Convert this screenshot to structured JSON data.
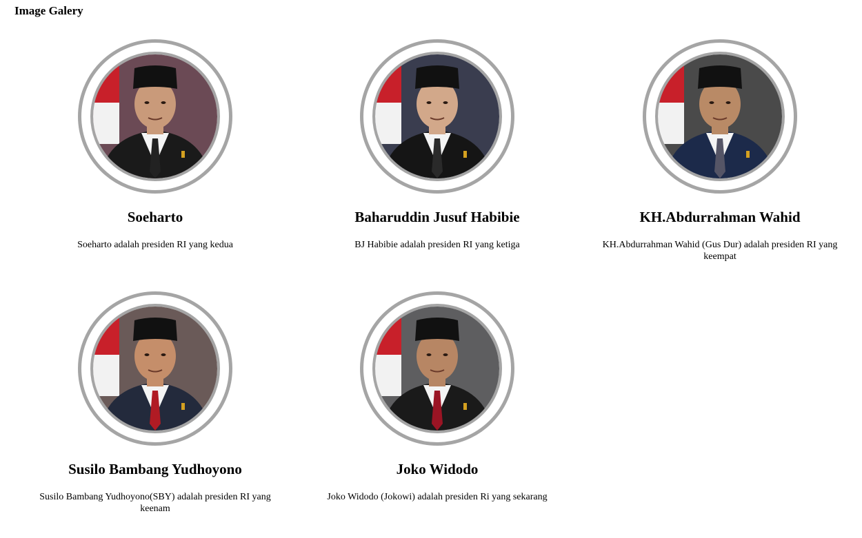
{
  "page": {
    "title": "Image Galery"
  },
  "gallery": {
    "items": [
      {
        "name": "Soeharto",
        "description": "Soeharto adalah presiden RI yang kedua",
        "photo_alt": "Portrait of Soeharto",
        "bg": "#6b4a55",
        "suit": "#1a1a1a",
        "tie": "#222222",
        "skin": "#c99a7a"
      },
      {
        "name": "Baharuddin Jusuf Habibie",
        "description": "BJ Habibie adalah presiden RI yang ketiga",
        "photo_alt": "Portrait of Baharuddin Jusuf Habibie",
        "bg": "#3a3d4f",
        "suit": "#151515",
        "tie": "#2a2a2a",
        "skin": "#d2a88a"
      },
      {
        "name": "KH.Abdurrahman Wahid",
        "description": "KH.Abdurrahman Wahid (Gus Dur) adalah presiden RI yang keempat",
        "photo_alt": "Portrait of KH.Abdurrahman Wahid",
        "bg": "#4a4a4a",
        "suit": "#1c2a4a",
        "tie": "#555566",
        "skin": "#b98a66"
      },
      {
        "name": "Susilo Bambang Yudhoyono",
        "description": "Susilo Bambang Yudhoyono(SBY) adalah presiden RI yang keenam",
        "photo_alt": "Portrait of Susilo Bambang Yudhoyono",
        "bg": "#6a5a58",
        "suit": "#232a3c",
        "tie": "#b01b24",
        "skin": "#c58e6a"
      },
      {
        "name": "Joko Widodo",
        "description": "Joko Widodo (Jokowi) adalah presiden Ri yang sekarang",
        "photo_alt": "Portrait of Joko Widodo",
        "bg": "#5e5e60",
        "suit": "#1a1a1a",
        "tie": "#9a1424",
        "skin": "#b78664"
      }
    ]
  }
}
